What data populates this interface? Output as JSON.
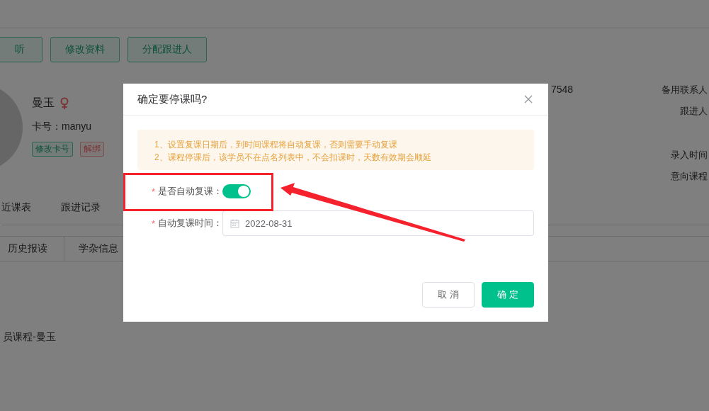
{
  "background": {
    "action_buttons": [
      "听",
      "修改资料",
      "分配跟进人"
    ],
    "student": {
      "name": "曼玉",
      "card_label": "卡号：manyu",
      "tags": [
        {
          "label": "修改卡号",
          "kind": "edit"
        },
        {
          "label": "解绑",
          "kind": "unbind"
        }
      ]
    },
    "phone_fragment": "7548",
    "info_labels": [
      "备用联系人",
      "跟进人",
      "录入时间",
      "意向课程"
    ],
    "tabs": [
      "近课表",
      "跟进记录"
    ],
    "subtabs": [
      "历史报读",
      "学杂信息"
    ],
    "list_items": [
      "员课程-曼玉"
    ]
  },
  "dialog": {
    "title": "确定要停课吗?",
    "notice": [
      "1、设置复课日期后，到时间课程将自动复课，否则需要手动复课",
      "2、课程停课后，该学员不在点名列表中，不会扣课时，天数有效期会顺延"
    ],
    "fields": [
      {
        "kind": "switch",
        "required": true,
        "required_mark": "*",
        "label": "是否自动复课：",
        "on": true
      },
      {
        "kind": "date",
        "required": true,
        "required_mark": "*",
        "label": "自动复课时间：",
        "value": "2022-08-31"
      }
    ],
    "buttons": [
      {
        "label": "取 消",
        "kind": "default"
      },
      {
        "label": "确 定",
        "kind": "primary"
      }
    ]
  }
}
